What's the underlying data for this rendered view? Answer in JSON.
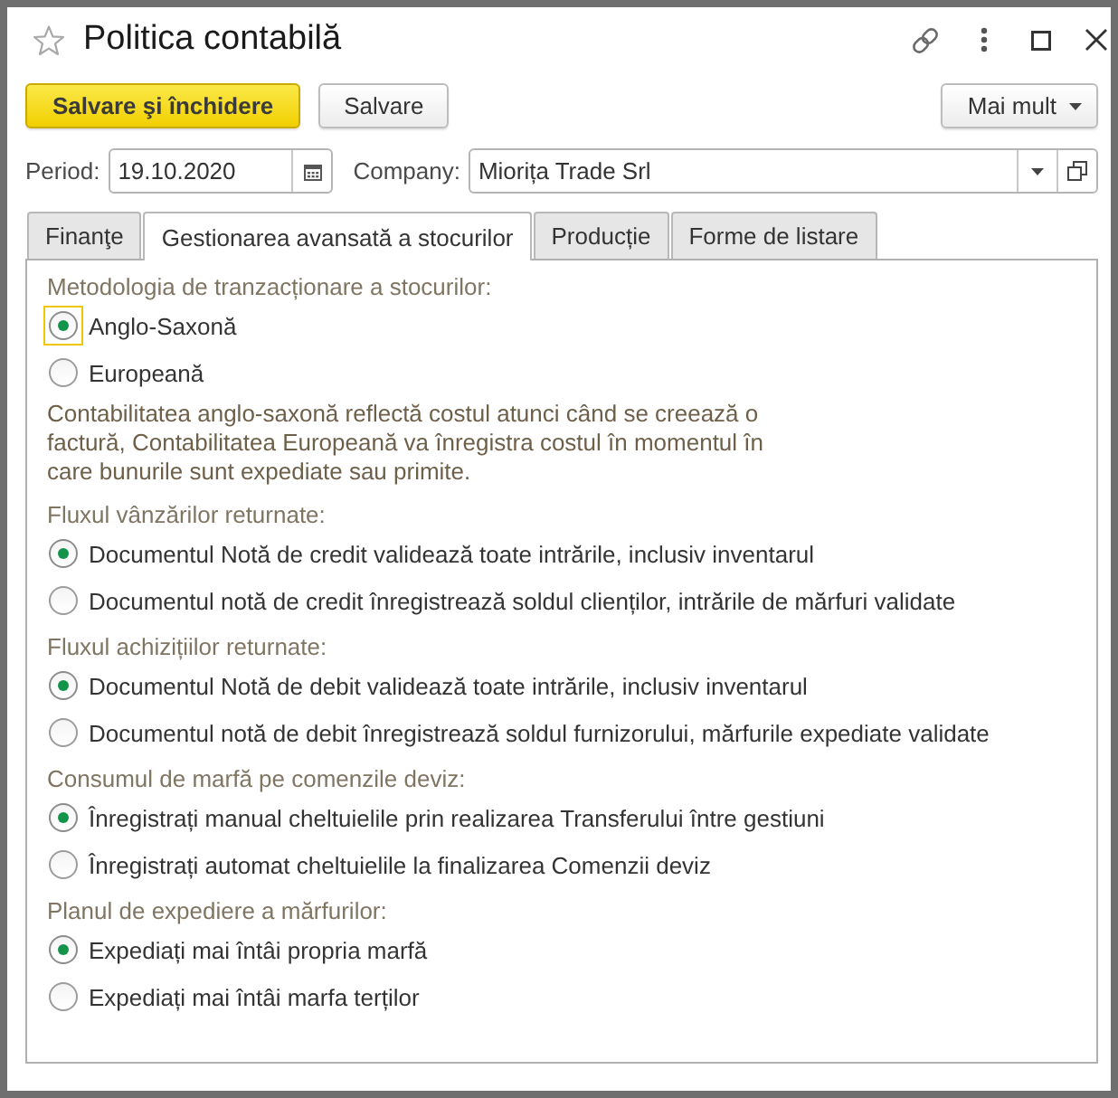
{
  "window": {
    "title": "Politica contabilă"
  },
  "toolbar": {
    "buttons": [
      {
        "label": "Salvare şi închidere",
        "kind": "primary"
      },
      {
        "label": "Salvare",
        "kind": "default"
      }
    ],
    "more_button": {
      "label": "Mai mult"
    }
  },
  "fields": {
    "period": {
      "label": "Period:",
      "value": "19.10.2020"
    },
    "company": {
      "label": "Company:",
      "value": "Miorița Trade Srl"
    }
  },
  "tabs": [
    {
      "label": "Finanţe",
      "selected": false
    },
    {
      "label": "Gestionarea avansată a stocurilor",
      "selected": true
    },
    {
      "label": "Producție",
      "selected": false
    },
    {
      "label": "Forme de listare",
      "selected": false
    }
  ],
  "sections": [
    {
      "label": "Metodologia de tranzacționare a stocurilor:",
      "options": [
        {
          "label": "Anglo-Saxonă",
          "selected": true,
          "focused": true
        },
        {
          "label": "Europeană",
          "selected": false,
          "focused": false
        }
      ],
      "note": "Contabilitatea anglo-saxonă reflectă costul atunci când se creează o factură, Contabilitatea Europeană va înregistra costul în momentul în care bunurile sunt expediate sau primite."
    },
    {
      "label": "Fluxul vânzărilor returnate:",
      "options": [
        {
          "label": "Documentul Notă de credit validează toate intrările, inclusiv inventarul",
          "selected": true,
          "focused": false
        },
        {
          "label": "Documentul notă de credit înregistrează soldul clienților, intrările de mărfuri validate",
          "selected": false,
          "focused": false
        }
      ]
    },
    {
      "label": "Fluxul achizițiilor returnate:",
      "options": [
        {
          "label": "Documentul Notă de debit validează toate intrările, inclusiv inventarul",
          "selected": true,
          "focused": false
        },
        {
          "label": "Documentul notă de debit înregistrează soldul furnizorului, mărfurile expediate validate",
          "selected": false,
          "focused": false
        }
      ]
    },
    {
      "label": "Consumul de marfă pe comenzile deviz:",
      "options": [
        {
          "label": "Înregistrați manual cheltuielile prin realizarea Transferului între gestiuni",
          "selected": true,
          "focused": false
        },
        {
          "label": "Înregistrați automat cheltuielile la finalizarea Comenzii deviz",
          "selected": false,
          "focused": false
        }
      ]
    },
    {
      "label": "Planul de expediere a mărfurilor:",
      "options": [
        {
          "label": "Expediați mai întâi propria marfă",
          "selected": true,
          "focused": false
        },
        {
          "label": "Expediați mai întâi marfa terților",
          "selected": false,
          "focused": false
        }
      ]
    }
  ]
}
